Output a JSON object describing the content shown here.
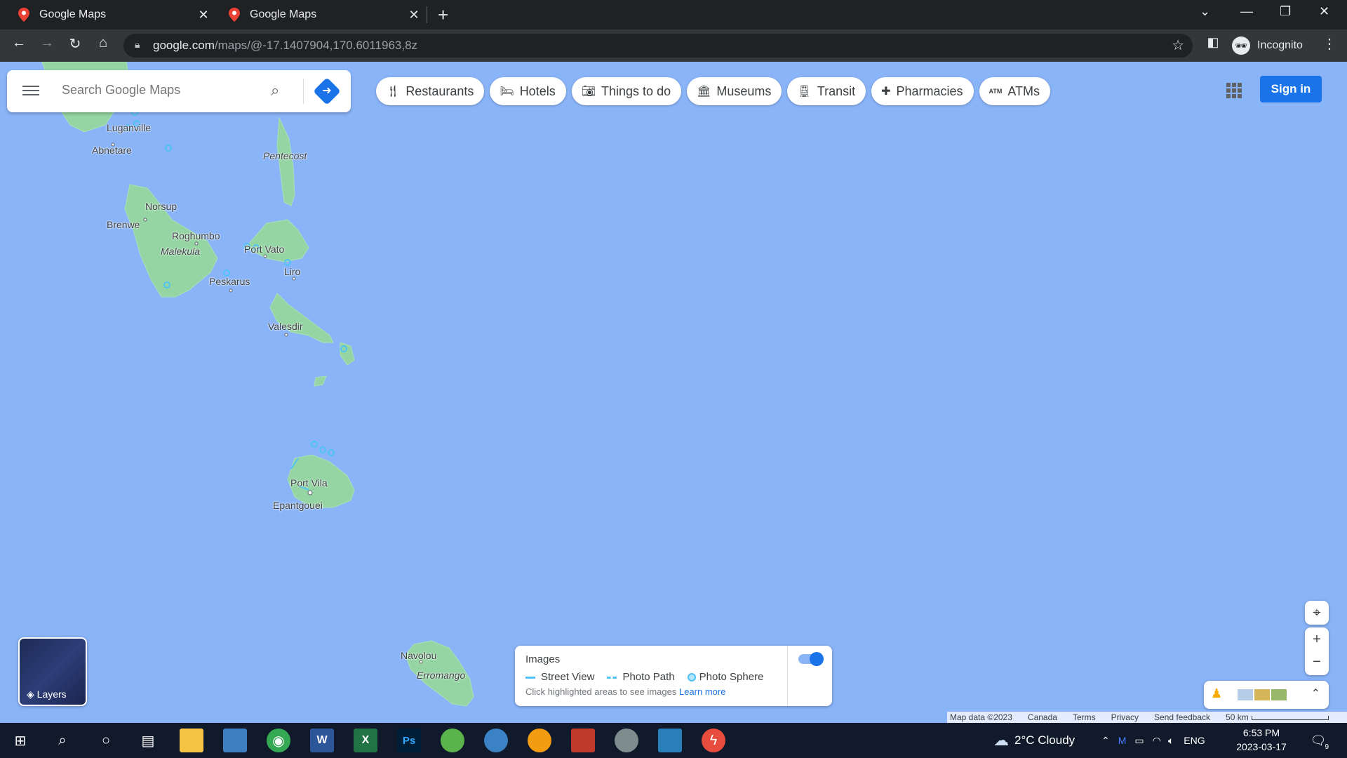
{
  "browser": {
    "tabs": [
      {
        "title": "Google Maps"
      },
      {
        "title": "Google Maps"
      }
    ],
    "url_domain": "google.com",
    "url_path": "/maps/@-17.1407904,170.6011963,8z",
    "profile_label": "Incognito"
  },
  "maps": {
    "search_placeholder": "Search Google Maps",
    "chips": [
      {
        "label": "Restaurants",
        "icon": "fork-knife-icon"
      },
      {
        "label": "Hotels",
        "icon": "bed-icon"
      },
      {
        "label": "Things to do",
        "icon": "camera-icon"
      },
      {
        "label": "Museums",
        "icon": "museum-icon"
      },
      {
        "label": "Transit",
        "icon": "train-icon"
      },
      {
        "label": "Pharmacies",
        "icon": "pharmacy-icon"
      },
      {
        "label": "ATMs",
        "icon": "atm-icon"
      }
    ],
    "sign_in": "Sign in",
    "places": [
      {
        "name": "Luganville",
        "style": "normal"
      },
      {
        "name": "Abnetare",
        "style": "normal"
      },
      {
        "name": "Pentecost",
        "style": "italic"
      },
      {
        "name": "Norsup",
        "style": "normal"
      },
      {
        "name": "Brenwe",
        "style": "normal"
      },
      {
        "name": "Roghumbo",
        "style": "normal"
      },
      {
        "name": "Malekula",
        "style": "italic"
      },
      {
        "name": "Port Vato",
        "style": "normal"
      },
      {
        "name": "Liro",
        "style": "normal"
      },
      {
        "name": "Peskarus",
        "style": "normal"
      },
      {
        "name": "Valesdir",
        "style": "normal"
      },
      {
        "name": "Port Vila",
        "style": "normal"
      },
      {
        "name": "Epantgouei",
        "style": "normal"
      },
      {
        "name": "Navolou",
        "style": "normal"
      },
      {
        "name": "Erromango",
        "style": "italic"
      }
    ],
    "layers_label": "Layers",
    "images_panel": {
      "title": "Images",
      "legend": [
        "Street View",
        "Photo Path",
        "Photo Sphere"
      ],
      "note": "Click highlighted areas to see images",
      "learn_more": "Learn more",
      "toggle_on": true
    },
    "footer": {
      "map_data": "Map data ©2023",
      "country": "Canada",
      "terms": "Terms",
      "privacy": "Privacy",
      "feedback": "Send feedback",
      "scale": "50 km"
    }
  },
  "taskbar": {
    "weather": "2°C  Cloudy",
    "language": "ENG",
    "time": "6:53 PM",
    "date": "2023-03-17",
    "notifications": "9"
  },
  "colors": {
    "water": "#8ab4f8",
    "land": "#95d5a3",
    "accent": "#1a73e8",
    "street_view": "#4fc3f7"
  }
}
